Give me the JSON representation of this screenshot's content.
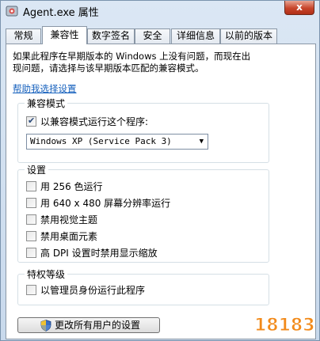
{
  "window": {
    "title": "Agent.exe 属性",
    "close_glyph": "x"
  },
  "tabs": [
    {
      "label": "常规"
    },
    {
      "label": "兼容性",
      "active": true
    },
    {
      "label": "数字签名"
    },
    {
      "label": "安全"
    },
    {
      "label": "详细信息"
    },
    {
      "label": "以前的版本"
    }
  ],
  "intro": {
    "line1": "如果此程序在早期版本的 Windows 上没有问题，而现在出",
    "line2": "现问题，请选择与该早期版本匹配的兼容模式。"
  },
  "help_link": "帮助我选择设置",
  "compat_mode": {
    "title": "兼容模式",
    "checkbox_label": "以兼容模式运行这个程序:",
    "checked": true,
    "selected_os": "Windows XP (Service Pack 3)"
  },
  "settings": {
    "title": "设置",
    "items": [
      {
        "label": "用 256 色运行",
        "checked": false
      },
      {
        "label": "用 640 x 480 屏幕分辨率运行",
        "checked": false
      },
      {
        "label": "禁用视觉主题",
        "checked": false
      },
      {
        "label": "禁用桌面元素",
        "checked": false
      },
      {
        "label": "高 DPI 设置时禁用显示缩放",
        "checked": false
      }
    ]
  },
  "privilege": {
    "title": "特权等级",
    "checkbox_label": "以管理员身份运行此程序",
    "checked": false
  },
  "change_all_button": "更改所有用户的设置",
  "watermark": "18183",
  "colors": {
    "link": "#1560bd",
    "close_button": "#c7452b",
    "watermark_orange": "#f28a1a"
  }
}
